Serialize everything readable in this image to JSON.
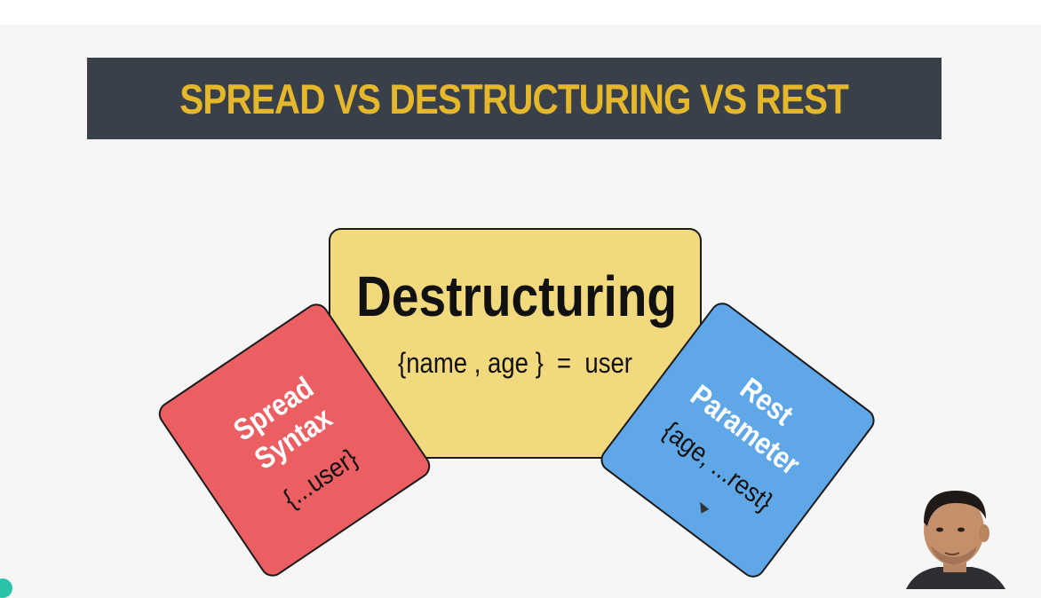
{
  "slide": {
    "title": "SPREAD VS DESTRUCTURING VS REST",
    "cards": {
      "destructuring": {
        "heading": "Destructuring",
        "code": "{name , age }  =  user"
      },
      "spread": {
        "title_line1": "Spread",
        "title_line2": "Syntax",
        "code": "{...user}"
      },
      "rest": {
        "title_line1": "Rest",
        "title_line2": "Parameter",
        "code": "{age, ...rest}"
      }
    }
  },
  "colors": {
    "banner_bg": "#3a4049",
    "banner_text": "#e5b82c",
    "destructuring_card": "#f3d97e",
    "spread_card": "#eb5e62",
    "rest_card": "#5fa7e7"
  }
}
